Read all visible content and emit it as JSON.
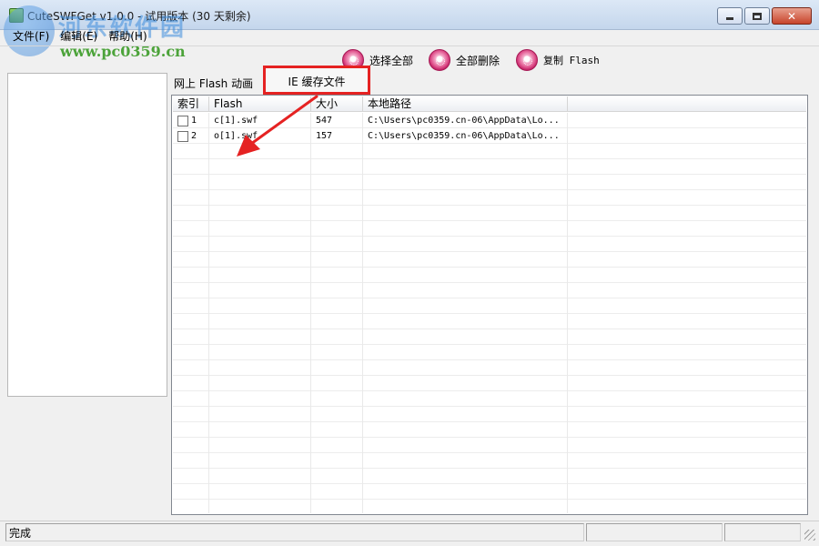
{
  "window": {
    "title": "CuteSWFGet v1.0.0 - 试用版本 (30 天剩余)",
    "close_glyph": "✕"
  },
  "watermark": {
    "title": "河东软件园",
    "url": "www.pc0359.cn"
  },
  "menu": {
    "items": [
      "文件(F)",
      "编辑(E)",
      "帮助(H)"
    ]
  },
  "toolbar": {
    "select_all_label": "选择全部",
    "delete_all_label": "全部删除",
    "copy_flash_label": "复制 Flash"
  },
  "tabs": {
    "web_flash_label": "网上 Flash 动画",
    "ie_cache_label": "IE 缓存文件"
  },
  "table": {
    "columns": [
      "索引",
      "Flash",
      "大小",
      "本地路径"
    ],
    "rows": [
      {
        "index": "1",
        "flash": "c[1].swf",
        "size": "547",
        "path": "C:\\Users\\pc0359.cn-06\\AppData\\Lo..."
      },
      {
        "index": "2",
        "flash": "o[1].swf",
        "size": "157",
        "path": "C:\\Users\\pc0359.cn-06\\AppData\\Lo..."
      }
    ]
  },
  "status": {
    "text": "完成"
  },
  "colors": {
    "highlight_box": "#e52222",
    "arrow": "#e52222"
  },
  "icons": {
    "toolbar": "flower-icon",
    "app": "app-icon"
  }
}
